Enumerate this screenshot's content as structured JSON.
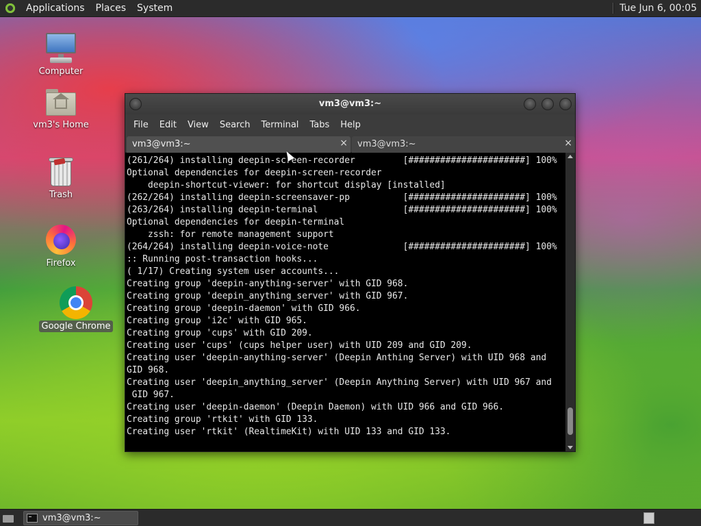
{
  "top_panel": {
    "menus": [
      "Applications",
      "Places",
      "System"
    ],
    "clock": "Tue Jun  6, 00:05"
  },
  "desktop_icons": [
    {
      "label": "Computer",
      "icon": "computer-icon"
    },
    {
      "label": "vm3's Home",
      "icon": "home-folder-icon"
    },
    {
      "label": "Trash",
      "icon": "trash-icon"
    },
    {
      "label": "Firefox",
      "icon": "firefox-icon"
    },
    {
      "label": "Google Chrome",
      "icon": "chrome-icon",
      "selected": true
    }
  ],
  "terminal": {
    "title": "vm3@vm3:~",
    "menu": [
      "File",
      "Edit",
      "View",
      "Search",
      "Terminal",
      "Tabs",
      "Help"
    ],
    "tabs": [
      {
        "label": "vm3@vm3:~",
        "close": "×"
      },
      {
        "label": "vm3@vm3:~",
        "close": "×"
      }
    ],
    "lines": [
      "(261/264) installing deepin-screen-recorder         [######################] 100%",
      "Optional dependencies for deepin-screen-recorder",
      "    deepin-shortcut-viewer: for shortcut display [installed]",
      "(262/264) installing deepin-screensaver-pp          [######################] 100%",
      "(263/264) installing deepin-terminal                [######################] 100%",
      "Optional dependencies for deepin-terminal",
      "    zssh: for remote management support",
      "(264/264) installing deepin-voice-note              [######################] 100%",
      ":: Running post-transaction hooks...",
      "( 1/17) Creating system user accounts...",
      "Creating group 'deepin-anything-server' with GID 968.",
      "Creating group 'deepin_anything_server' with GID 967.",
      "Creating group 'deepin-daemon' with GID 966.",
      "Creating group 'i2c' with GID 965.",
      "Creating group 'cups' with GID 209.",
      "Creating user 'cups' (cups helper user) with UID 209 and GID 209.",
      "Creating user 'deepin-anything-server' (Deepin Anthing Server) with UID 968 and",
      "GID 968.",
      "Creating user 'deepin_anything_server' (Deepin Anything Server) with UID 967 and",
      " GID 967.",
      "Creating user 'deepin-daemon' (Deepin Daemon) with UID 966 and GID 966.",
      "Creating group 'rtkit' with GID 133.",
      "Creating user 'rtkit' (RealtimeKit) with UID 133 and GID 133."
    ]
  },
  "taskbar": {
    "items": [
      {
        "label": "vm3@vm3:~",
        "icon": "terminal-icon"
      }
    ]
  }
}
